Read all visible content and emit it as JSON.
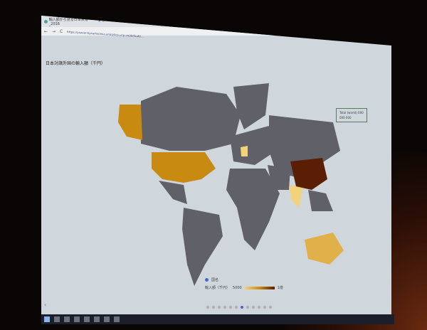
{
  "browser": {
    "tab_title": "輸入額から見る日本貿易_2016",
    "new_tab": "+",
    "back": "←",
    "forward": "→",
    "reload": "C",
    "url": "https://ysaver-bysamsonsa.analytics.ucp.cn/default/..."
  },
  "page": {
    "title": "日本対諸外国の輸入額（千円）"
  },
  "infobox": {
    "line1": "Total (world) 000",
    "line2": "000 000"
  },
  "legend": {
    "series_label": "国名",
    "scale_label": "輸入額（千円）",
    "min": "5000",
    "max": "1億"
  },
  "colors": {
    "land": "#5f6068",
    "low": "#f2d27a",
    "mid": "#c88a10",
    "high": "#5a1e04",
    "background": "#cfd6dc"
  },
  "pager": {
    "count": 12,
    "active": 6
  },
  "nav": {
    "prev": "‹"
  }
}
